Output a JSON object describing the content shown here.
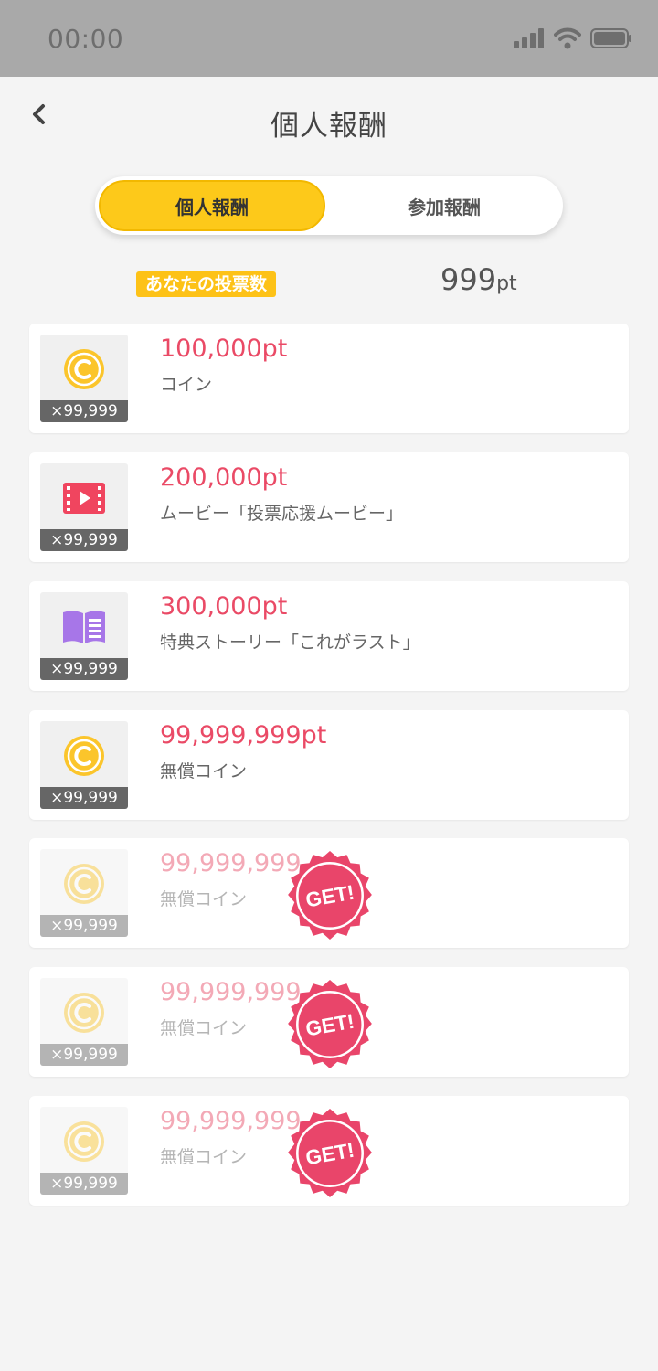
{
  "status_bar": {
    "time": "00:00"
  },
  "header": {
    "title": "個人報酬"
  },
  "tabs": [
    {
      "label": "個人報酬",
      "active": true
    },
    {
      "label": "参加報酬",
      "active": false
    }
  ],
  "votes": {
    "label": "あなたの投票数",
    "value": "999",
    "unit": "pt"
  },
  "rewards": [
    {
      "points": "100,000pt",
      "name": "コイン",
      "quantity": "×99,999",
      "icon": "coin-icon",
      "obtained": false
    },
    {
      "points": "200,000pt",
      "name": "ムービー「投票応援ムービー」",
      "quantity": "×99,999",
      "icon": "movie-icon",
      "obtained": false
    },
    {
      "points": "300,000pt",
      "name": "特典ストーリー「これがラスト」",
      "quantity": "×99,999",
      "icon": "book-icon",
      "obtained": false
    },
    {
      "points": "99,999,999pt",
      "name": "無償コイン",
      "quantity": "×99,999",
      "icon": "coin-icon",
      "obtained": false
    },
    {
      "points": "99,999,999",
      "name": "無償コイン",
      "quantity": "×99,999",
      "icon": "coin-icon",
      "obtained": true,
      "badge": "GET!"
    },
    {
      "points": "99,999,999",
      "name": "無償コイン",
      "quantity": "×99,999",
      "icon": "coin-icon",
      "obtained": true,
      "badge": "GET!"
    },
    {
      "points": "99,999,999",
      "name": "無償コイン",
      "quantity": "×99,999",
      "icon": "coin-icon",
      "obtained": true,
      "badge": "GET!"
    }
  ],
  "colors": {
    "accent": "#fdc91a",
    "points": "#ea4a66",
    "badge": "#e9456a"
  }
}
